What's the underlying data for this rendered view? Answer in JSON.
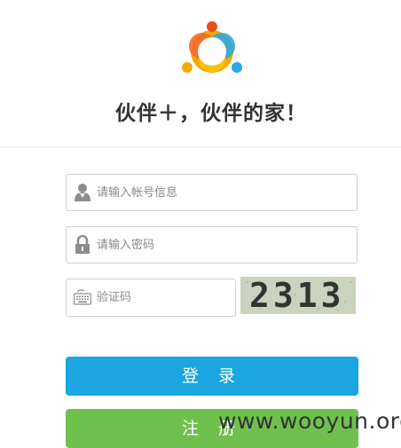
{
  "header": {
    "slogan": "伙伴＋，伙伴的家！"
  },
  "form": {
    "account_placeholder": "请输入帐号信息",
    "password_placeholder": "请输入密码",
    "captcha_placeholder": "验证码",
    "captcha_text": "2313"
  },
  "buttons": {
    "login_label": "登 录",
    "register_label": "注 册"
  },
  "watermark": "www.wooyun.org",
  "icons": {
    "logo": "people-circle-logo",
    "account": "user-icon",
    "password": "lock-icon",
    "captcha": "keyboard-icon"
  },
  "colors": {
    "login": "#1ba6e2",
    "register": "#70c04e"
  }
}
